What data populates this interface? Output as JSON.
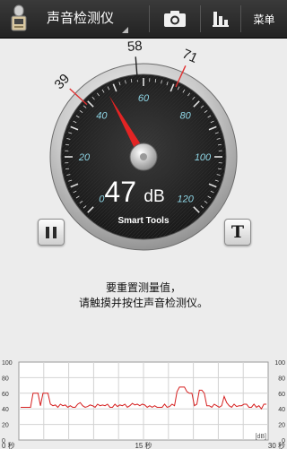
{
  "app": {
    "title": "声音检测仪"
  },
  "toolbar": {
    "menu_label": "菜单"
  },
  "meter": {
    "value": 47,
    "unit": "dB",
    "brand": "Smart Tools",
    "scale_min": 0,
    "scale_max": 120,
    "scale_labels": [
      "0",
      "20",
      "40",
      "60",
      "80",
      "100",
      "120"
    ],
    "markers": [
      {
        "label": "39",
        "value": 39,
        "color": "#e03030"
      },
      {
        "label": "58",
        "value": 58,
        "color": "#222222"
      },
      {
        "label": "71",
        "value": 71,
        "color": "#e03030"
      }
    ]
  },
  "controls": {
    "pause_icon": "pause-icon",
    "theme_label": "T"
  },
  "hint": {
    "line1": "要重置测量值，",
    "line2": "请触摸并按住声音检测仪。"
  },
  "chart_data": {
    "type": "line",
    "ylim": [
      0,
      100
    ],
    "yticks": [
      "100",
      "80",
      "60",
      "40",
      "20",
      "0"
    ],
    "unit_label": "[dB]",
    "xlabels": [
      "0 秒",
      "15 秒",
      "30 秒"
    ],
    "series": [
      {
        "color": "#d62020",
        "values": [
          42,
          42,
          42,
          42,
          42,
          60,
          60,
          60,
          44,
          60,
          60,
          60,
          46,
          44,
          45,
          42,
          46,
          44,
          45,
          42,
          44,
          42,
          42,
          46,
          48,
          44,
          42,
          43,
          45,
          44,
          42,
          46,
          44,
          45,
          44,
          46,
          42,
          42,
          46,
          43,
          45,
          44,
          46,
          42,
          44,
          47,
          45,
          46,
          44,
          46,
          45,
          42,
          44,
          42,
          44,
          42,
          42,
          42,
          46,
          42,
          43,
          46,
          44,
          62,
          68,
          68,
          68,
          62,
          60,
          60,
          44,
          46,
          64,
          64,
          60,
          44,
          44,
          42,
          46,
          44,
          42,
          44,
          56,
          48,
          44,
          42,
          46,
          43,
          44,
          44,
          46,
          46,
          42,
          42,
          46,
          42,
          44,
          40,
          46,
          46
        ]
      }
    ]
  },
  "colors": {
    "actionbar": "#2b2b2b",
    "accent_red": "#e03030",
    "scale_text": "#8fd6e6",
    "background": "#ececec"
  }
}
